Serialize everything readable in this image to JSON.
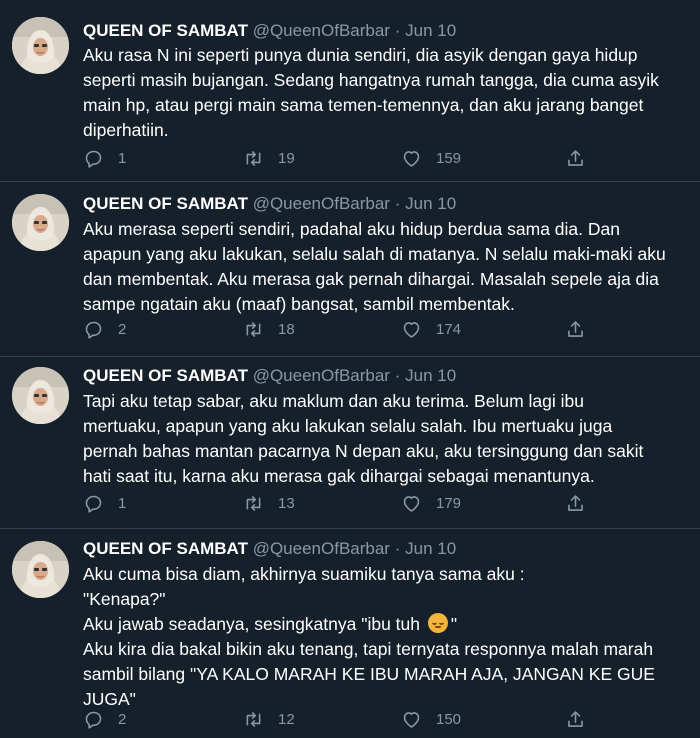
{
  "tweets": [
    {
      "name": "QUEEN OF SAMBAT",
      "handle": "@QueenOfBarbar",
      "date": "Jun 10",
      "text": "Aku rasa N ini seperti punya dunia sendiri, dia asyik dengan gaya hidup\nseperti masih bujangan. Sedang hangatnya rumah tangga, dia cuma asyik\nmain hp, atau pergi main sama temen-temennya, dan aku jarang banget\ndiperhatiin.",
      "replies": "1",
      "retweets": "19",
      "likes": "159"
    },
    {
      "name": "QUEEN OF SAMBAT",
      "handle": "@QueenOfBarbar",
      "date": "Jun 10",
      "text": "Aku merasa seperti sendiri, padahal aku hidup berdua sama dia. Dan\napapun yang aku lakukan, selalu salah di matanya. N selalu maki-maki aku\ndan membentak. Aku merasa gak pernah dihargai. Masalah sepele aja dia\nsampe ngatain aku (maaf) bangsat, sambil membentak.",
      "replies": "2",
      "retweets": "18",
      "likes": "174"
    },
    {
      "name": "QUEEN OF SAMBAT",
      "handle": "@QueenOfBarbar",
      "date": "Jun 10",
      "text": "Tapi aku tetap sabar, aku maklum dan aku terima. Belum lagi ibu\nmertuaku, apapun yang aku lakukan selalu salah. Ibu mertuaku juga\npernah bahas mantan pacarnya N depan aku, aku tersinggung dan sakit\nhati saat itu, karna aku merasa gak dihargai sebagai menantunya.",
      "replies": "1",
      "retweets": "13",
      "likes": "179"
    },
    {
      "name": "QUEEN OF SAMBAT",
      "handle": "@QueenOfBarbar",
      "date": "Jun 10",
      "text_lines": [
        "Aku cuma bisa diam, akhirnya suamiku tanya sama aku :",
        "\"Kenapa?\"",
        "Aku jawab seadanya, sesingkatnya \"ibu tuh ",
        "Aku kira dia bakal bikin aku tenang, tapi ternyata responnya malah marah",
        "sambil bilang \"YA KALO MARAH KE IBU MARAH AJA, JANGAN KE GUE",
        "JUGA\""
      ],
      "text_line3_end": "\"",
      "emoji_icon": "relieved-face-emoji",
      "replies": "2",
      "retweets": "12",
      "likes": "150"
    }
  ],
  "colors": {
    "background": "#15202b",
    "text": "#ffffff",
    "secondary": "#8899a6",
    "divider": "#38444d"
  }
}
